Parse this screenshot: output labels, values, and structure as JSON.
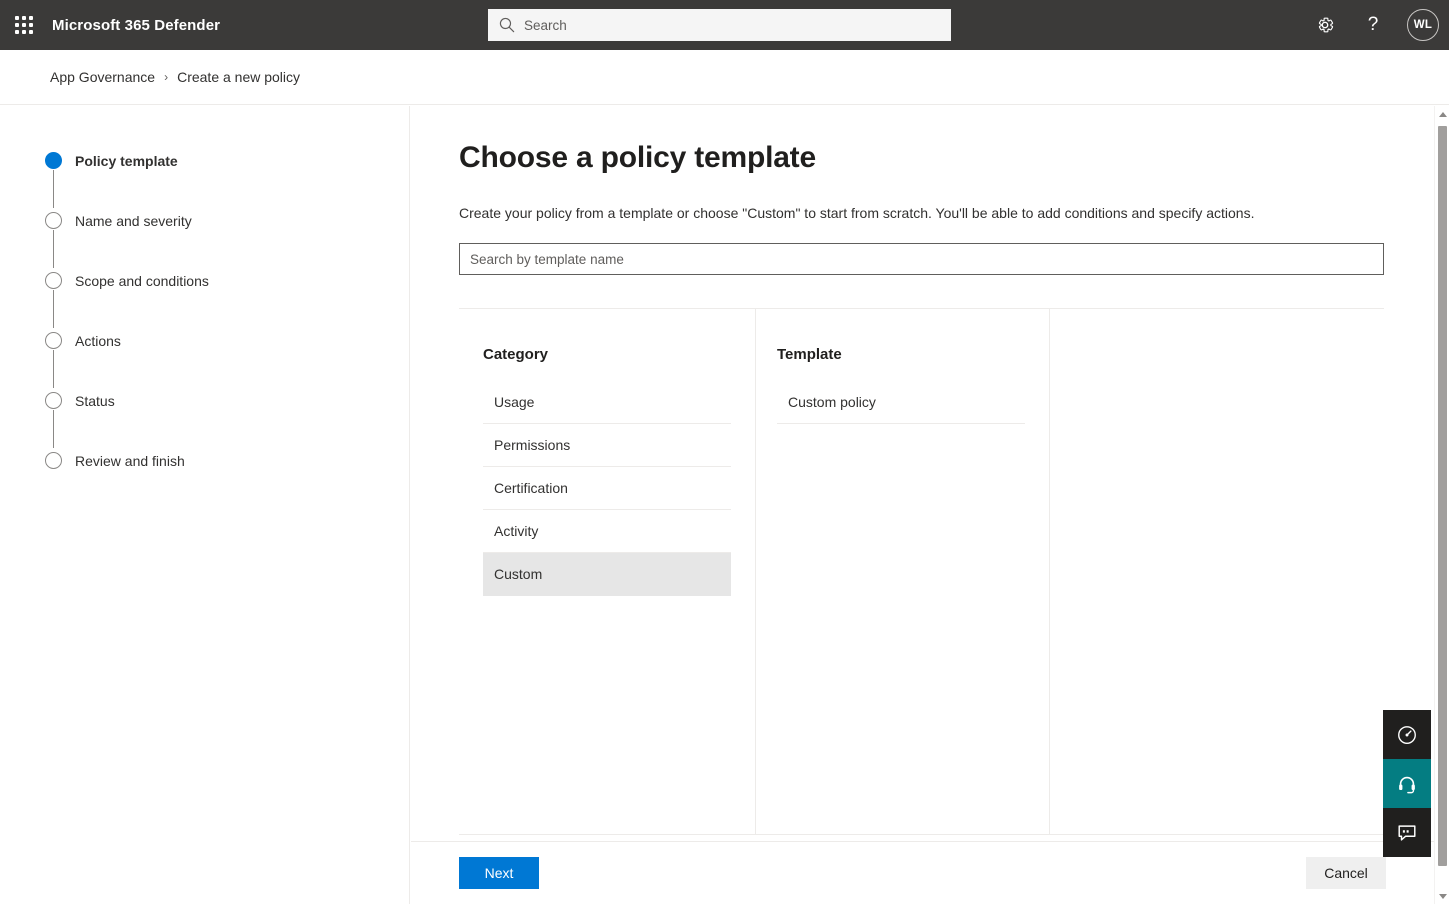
{
  "suite": {
    "waffle_label": "app-launcher",
    "title": "Microsoft 365 Defender",
    "search_placeholder": "Search",
    "search_value": "",
    "settings_label": "Settings",
    "help_label": "?",
    "avatar_initials": "WL"
  },
  "breadcrumb": {
    "parent": "App Governance",
    "separator": "›",
    "current": "Create a new policy"
  },
  "wizard": {
    "steps": [
      {
        "label": "Policy template",
        "state": "active"
      },
      {
        "label": "Name and severity",
        "state": "pending"
      },
      {
        "label": "Scope and conditions",
        "state": "pending"
      },
      {
        "label": "Actions",
        "state": "pending"
      },
      {
        "label": "Status",
        "state": "pending"
      },
      {
        "label": "Review and finish",
        "state": "pending"
      }
    ]
  },
  "main": {
    "title": "Choose a policy template",
    "description": "Create your policy from a template or choose \"Custom\" to start from scratch. You'll be able to add conditions and specify actions.",
    "template_search_placeholder": "Search by template name",
    "template_search_value": "",
    "category": {
      "heading": "Category",
      "items": [
        {
          "label": "Usage",
          "selected": false
        },
        {
          "label": "Permissions",
          "selected": false
        },
        {
          "label": "Certification",
          "selected": false
        },
        {
          "label": "Activity",
          "selected": false
        },
        {
          "label": "Custom",
          "selected": true
        }
      ]
    },
    "template": {
      "heading": "Template",
      "items": [
        {
          "label": "Custom policy",
          "selected": false
        }
      ]
    },
    "detail": {
      "content": ""
    }
  },
  "footer": {
    "next_label": "Next",
    "cancel_label": "Cancel"
  },
  "widgets": [
    {
      "name": "dashboard-gauge",
      "style": "dark"
    },
    {
      "name": "support-headset",
      "style": "teal"
    },
    {
      "name": "feedback-chat",
      "style": "dark"
    }
  ],
  "colors": {
    "accent": "#0078d4",
    "suite_bar": "#3b3a39",
    "teal_widget": "#047d82",
    "selected_row": "#e6e6e6",
    "divider": "#edebe9"
  }
}
